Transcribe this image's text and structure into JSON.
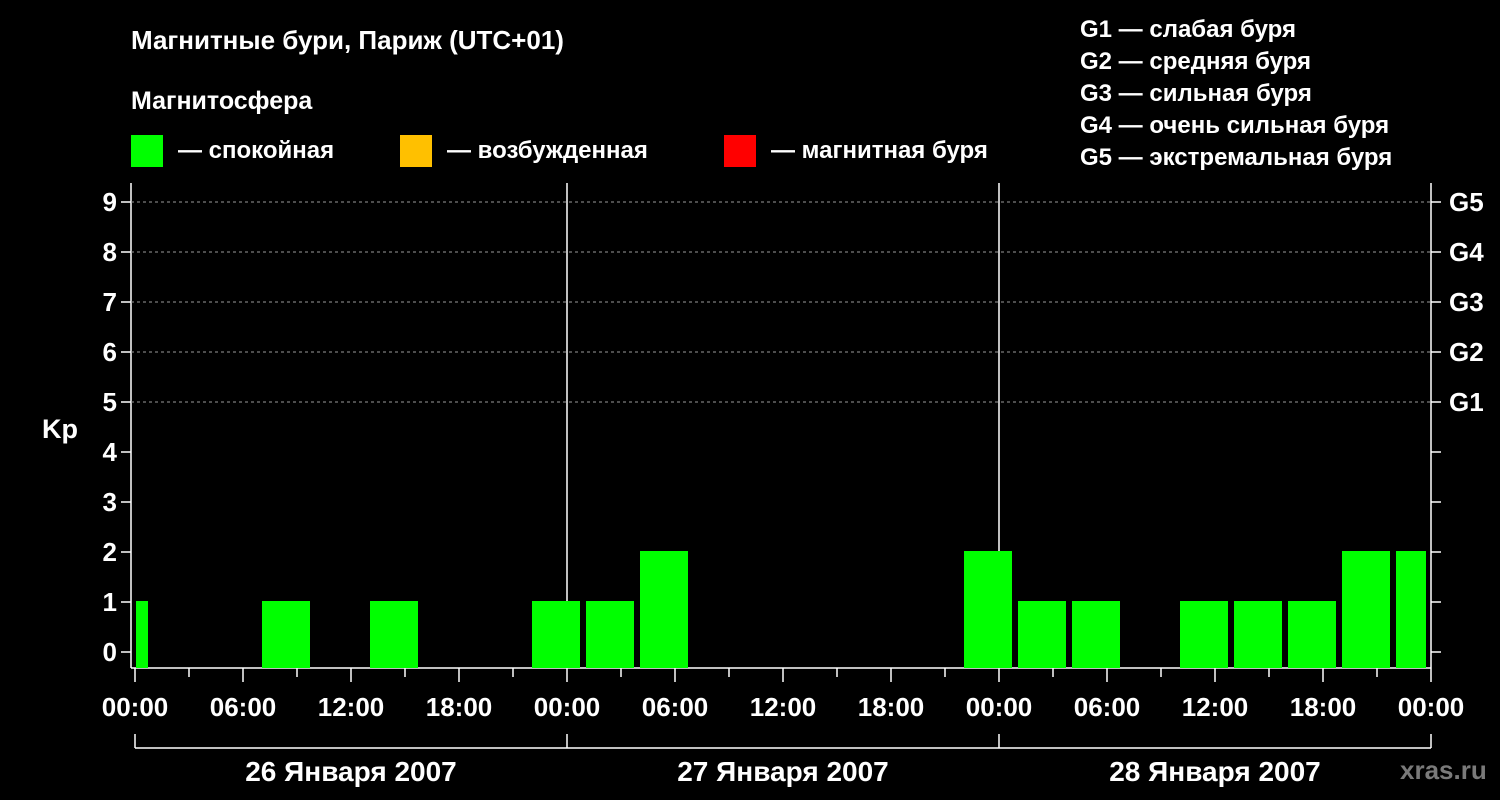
{
  "chart_data": {
    "type": "bar",
    "title": "Магнитные бури, Париж (UTC+01)",
    "legend_title": "Магнитосфера",
    "legend": [
      {
        "label": "— спокойная",
        "color": "#00ff00"
      },
      {
        "label": "— возбужденная",
        "color": "#ffc000"
      },
      {
        "label": "— магнитная буря",
        "color": "#ff0000"
      }
    ],
    "g_scale": [
      "G1 — слабая буря",
      "G2 — средняя буря",
      "G3 — сильная буря",
      "G4 — очень сильная буря",
      "G5 — экстремальная буря"
    ],
    "ylabel": "Kp",
    "ylim": [
      0,
      9
    ],
    "y_ticks": [
      "0",
      "1",
      "2",
      "3",
      "4",
      "5",
      "6",
      "7",
      "8",
      "9"
    ],
    "right_ticks": [
      {
        "kp": 5,
        "label": "G1"
      },
      {
        "kp": 6,
        "label": "G2"
      },
      {
        "kp": 7,
        "label": "G3"
      },
      {
        "kp": 8,
        "label": "G4"
      },
      {
        "kp": 9,
        "label": "G5"
      }
    ],
    "x_tick_labels": [
      "00:00",
      "06:00",
      "12:00",
      "18:00",
      "00:00",
      "06:00",
      "12:00",
      "18:00",
      "00:00",
      "06:00",
      "12:00",
      "18:00",
      "00:00"
    ],
    "days": [
      "26 Января 2007",
      "27 Января 2007",
      "28 Января 2007"
    ],
    "grid": "dashed horizontal at Kp 5-9",
    "series": [
      {
        "bars": [
          {
            "start": "2007-01-26 00:00",
            "end": "2007-01-26 01:00",
            "kp": 1
          },
          {
            "start": "2007-01-26 07:00",
            "end": "2007-01-26 10:00",
            "kp": 1
          },
          {
            "start": "2007-01-26 13:00",
            "end": "2007-01-26 16:00",
            "kp": 1
          },
          {
            "start": "2007-01-26 22:00",
            "end": "2007-01-27 01:00",
            "kp": 1
          },
          {
            "start": "2007-01-27 01:00",
            "end": "2007-01-27 04:00",
            "kp": 1
          },
          {
            "start": "2007-01-27 04:00",
            "end": "2007-01-27 07:00",
            "kp": 2
          },
          {
            "start": "2007-01-27 22:00",
            "end": "2007-01-28 01:00",
            "kp": 2
          },
          {
            "start": "2007-01-28 01:00",
            "end": "2007-01-28 04:00",
            "kp": 1
          },
          {
            "start": "2007-01-28 04:00",
            "end": "2007-01-28 07:00",
            "kp": 1
          },
          {
            "start": "2007-01-28 10:00",
            "end": "2007-01-28 13:00",
            "kp": 1
          },
          {
            "start": "2007-01-28 13:00",
            "end": "2007-01-28 16:00",
            "kp": 1
          },
          {
            "start": "2007-01-28 16:00",
            "end": "2007-01-28 19:00",
            "kp": 1
          },
          {
            "start": "2007-01-28 19:00",
            "end": "2007-01-28 22:00",
            "kp": 2
          },
          {
            "start": "2007-01-28 22:00",
            "end": "2007-01-29 00:00",
            "kp": 2
          }
        ]
      }
    ]
  },
  "credit": "xras.ru"
}
